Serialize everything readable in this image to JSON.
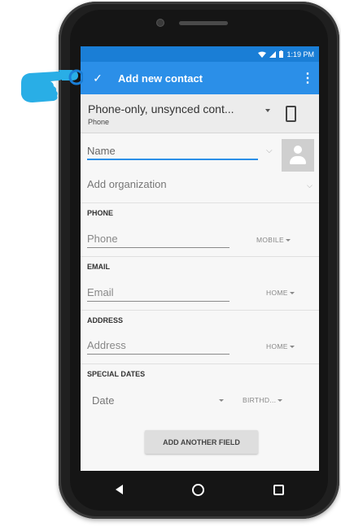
{
  "status_bar": {
    "time": "1:19 PM",
    "signal_icon": "wifi-icon",
    "battery_icon": "battery-icon"
  },
  "app_bar": {
    "title": "Add new contact",
    "confirm_icon": "check-icon",
    "menu_icon": "overflow-menu-icon"
  },
  "account": {
    "name": "Phone-only, unsynced cont...",
    "type": "Phone"
  },
  "name_field": {
    "placeholder": "Name"
  },
  "organization": {
    "label": "Add organization"
  },
  "sections": {
    "phone": {
      "header": "PHONE",
      "placeholder": "Phone",
      "type": "MOBILE"
    },
    "email": {
      "header": "EMAIL",
      "placeholder": "Email",
      "type": "HOME"
    },
    "address": {
      "header": "ADDRESS",
      "placeholder": "Address",
      "type": "HOME"
    },
    "special_dates": {
      "header": "SPECIAL DATES",
      "placeholder": "Date",
      "type": "BIRTHD..."
    }
  },
  "add_field_button": {
    "label": "ADD ANOTHER FIELD"
  },
  "colors": {
    "accent": "#2b8fe8",
    "status": "#1a7ed6",
    "hand": "#29aee6"
  }
}
